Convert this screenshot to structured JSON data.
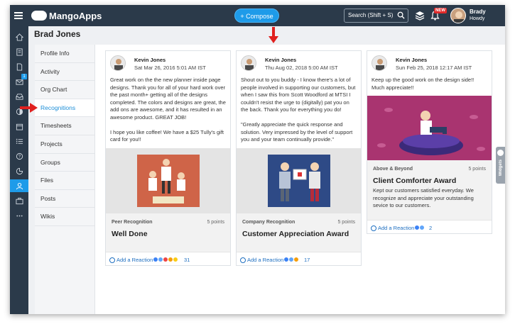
{
  "app": {
    "name": "MangoApps"
  },
  "topbar": {
    "compose_label": "+ Compose",
    "search_placeholder": "Search (Shift + S)",
    "notification_badge": "NEW",
    "user_name": "Brady",
    "user_status": "Howdy"
  },
  "leftnav": {
    "items": [
      "home-icon",
      "feed-icon",
      "document-icon",
      "mail-icon",
      "inbox-icon",
      "recognition-icon",
      "calendar-icon",
      "tasks-icon",
      "help-icon",
      "analytics-icon",
      "profile-icon",
      "briefcase-icon",
      "more-icon"
    ],
    "mail_badge": "1",
    "active": "profile-icon"
  },
  "profile": {
    "name": "Brad Jones"
  },
  "subnav": {
    "items": [
      {
        "label": "Profile Info"
      },
      {
        "label": "Activity"
      },
      {
        "label": "Org Chart"
      },
      {
        "label": "Recognitions"
      },
      {
        "label": "Timesheets"
      },
      {
        "label": "Projects"
      },
      {
        "label": "Groups"
      },
      {
        "label": "Files"
      },
      {
        "label": "Posts"
      },
      {
        "label": "Wikis"
      }
    ],
    "active": "Recognitions"
  },
  "cards": [
    {
      "author": "Kevin Jones",
      "date": "Sat Mar 26, 2016 5:01 AM IST",
      "message": "Great work on the the new planner inside page designs. Thank you for all of your hard work over the past month+ getting all of the designs completed. The colors and designs are great, the add ons are awesome, and it has resulted in an awesome product. GREAT JOB!\n\nI hope you like coffee! We have a $25 Tully's gift card for you!!",
      "award_type": "Peer Recognition",
      "points": "5 points",
      "award_title": "Well Done",
      "award_desc": "",
      "reaction_label": "Add a Reaction",
      "reaction_count": "31"
    },
    {
      "author": "Kevin Jones",
      "date": "Thu Aug 02, 2018 5:00 AM IST",
      "message": "Shout out to you buddy - I know there's a lot of people involved in supporting our customers, but when I saw this from Scott Woodford at MTSI I couldn't resist the urge to (digitally) pat you on the back. Thank you for everything you do!\n\n\"Greatly appreciate the quick response and solution. Very impressed by the level of support you and your team continually provide.\"",
      "award_type": "Company Recognition",
      "points": "5 points",
      "award_title": "Customer Appreciation Award",
      "award_desc": "",
      "reaction_label": "Add a Reaction",
      "reaction_count": "17"
    },
    {
      "author": "Kevin Jones",
      "date": "Sun Feb 25, 2018 12:17 AM IST",
      "message": "Keep up the good work on the design side!! Much appreciate!!",
      "award_type": "Above & Beyond",
      "points": "5 points",
      "award_title": "Client Comforter Award",
      "award_desc": "Kept our customers satisfied everyday. We recognize and appreciate your outstanding sevice to our customers.",
      "reaction_label": "Add a Reaction",
      "reaction_count": "2"
    }
  ],
  "widgets": {
    "label": "Widgets"
  },
  "colors": {
    "topbar": "#2b3a4a",
    "accent": "#1e9be9",
    "annotation_arrow": "#e0201e"
  }
}
